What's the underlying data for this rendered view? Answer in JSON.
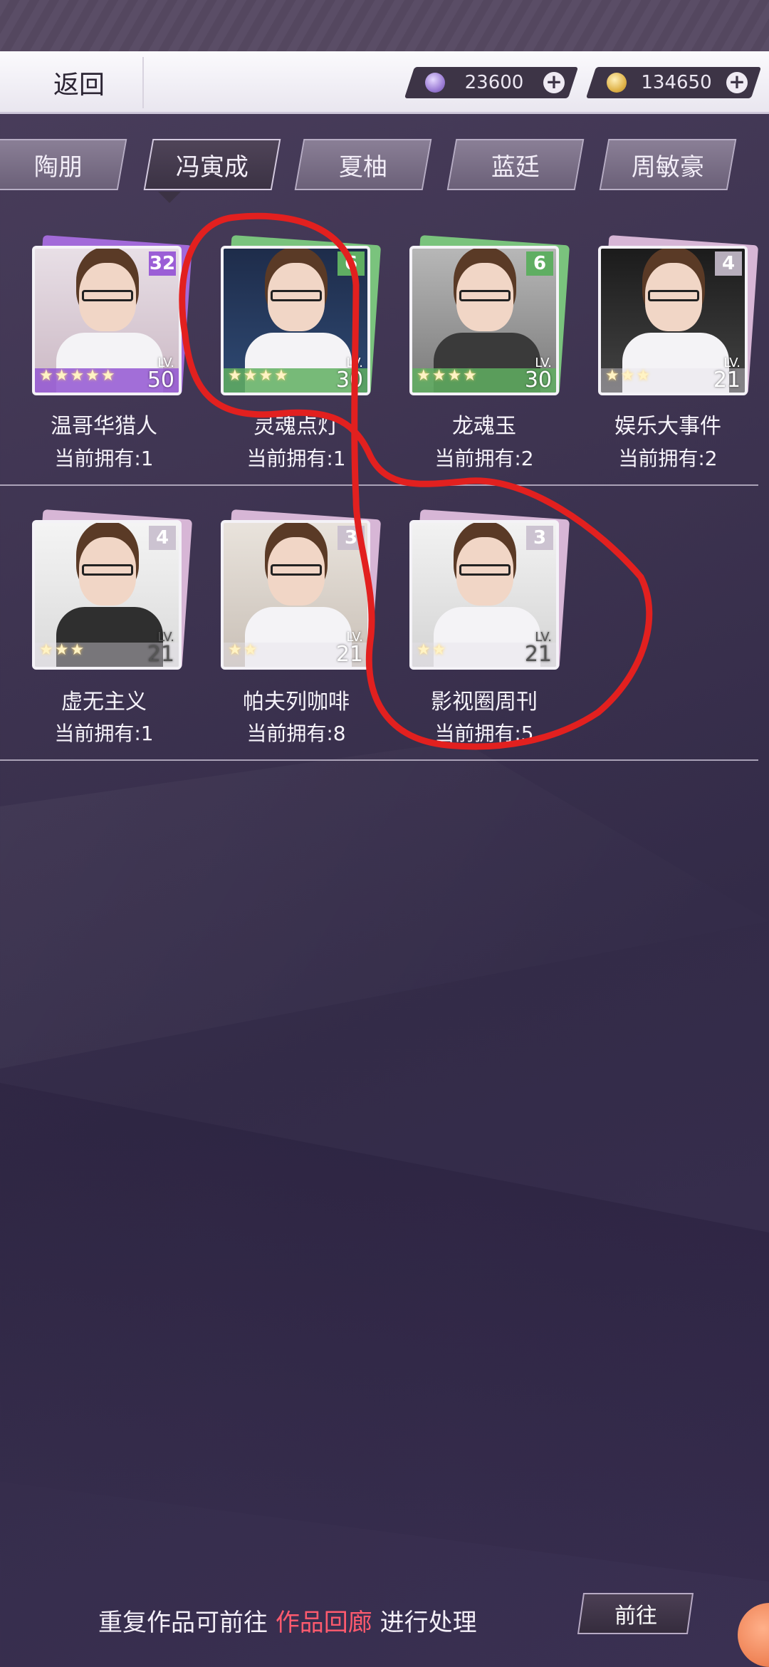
{
  "topbar": {
    "back_label": "返回",
    "currency": [
      {
        "icon": "diamond-icon",
        "value": "23600"
      },
      {
        "icon": "gold-coin-icon",
        "value": "134650"
      }
    ]
  },
  "tabs": [
    {
      "label": "陶朋",
      "active": false
    },
    {
      "label": "冯寅成",
      "active": true
    },
    {
      "label": "夏柚",
      "active": false
    },
    {
      "label": "蓝廷",
      "active": false
    },
    {
      "label": "周敏豪",
      "active": false
    }
  ],
  "cards": [
    {
      "name": "温哥华猎人",
      "owned": "当前拥有:1",
      "badge": "32",
      "stars": "★★★★★",
      "lv_label": "LV.",
      "level": "50",
      "rarity": "purple"
    },
    {
      "name": "灵魂点灯",
      "owned": "当前拥有:1",
      "badge": "6",
      "stars": "★★★★",
      "lv_label": "LV.",
      "level": "30",
      "rarity": "green"
    },
    {
      "name": "龙魂玉",
      "owned": "当前拥有:2",
      "badge": "6",
      "stars": "★★★★",
      "lv_label": "LV.",
      "level": "30",
      "rarity": "green"
    },
    {
      "name": "娱乐大事件",
      "owned": "当前拥有:2",
      "badge": "4",
      "stars": "★★★",
      "lv_label": "LV.",
      "level": "21",
      "rarity": "pink"
    },
    {
      "name": "虚无主义",
      "owned": "当前拥有:1",
      "badge": "4",
      "stars": "★★★",
      "lv_label": "LV.",
      "level": "21",
      "rarity": "pink"
    },
    {
      "name": "帕夫列咖啡",
      "owned": "当前拥有:8",
      "badge": "3",
      "stars": "★★",
      "lv_label": "LV.",
      "level": "21",
      "rarity": "pink"
    },
    {
      "name": "影视圈周刊",
      "owned": "当前拥有:5",
      "badge": "3",
      "stars": "★★",
      "lv_label": "LV.",
      "level": "21",
      "rarity": "pink"
    }
  ],
  "bottom": {
    "text_before": "重复作品可前往 ",
    "link": "作品回廊",
    "text_after": " 进行处理",
    "go_label": "前往"
  },
  "colors": {
    "accent_link": "#ff5a6e",
    "annotation_red": "#e2201f"
  }
}
